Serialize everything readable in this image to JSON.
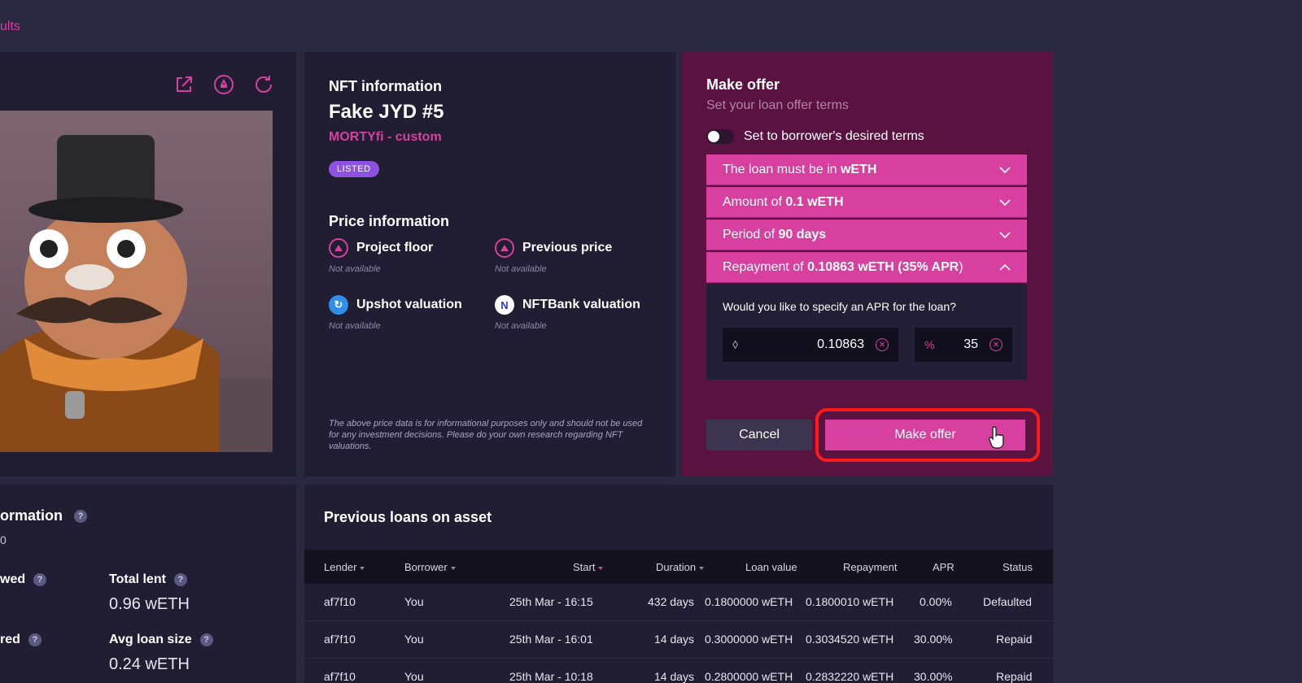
{
  "breadcrumb": {
    "text": "ults"
  },
  "info": {
    "heading": "NFT information",
    "nft_name": "Fake JYD #5",
    "collection": "MORTYfi - custom",
    "badge": "LISTED",
    "price_heading": "Price information",
    "items": [
      {
        "label": "Project floor",
        "value": "Not available",
        "icon": "floor-icon"
      },
      {
        "label": "Previous price",
        "value": "Not available",
        "icon": "price-icon"
      },
      {
        "label": "Upshot valuation",
        "value": "Not available",
        "icon": "upshot-icon"
      },
      {
        "label": "NFTBank valuation",
        "value": "Not available",
        "icon": "nftbank-icon"
      }
    ],
    "disclaimer": "The above price data is for informational purposes only and should not be used for any investment decisions. Please do your own research regarding NFT valuations."
  },
  "offer": {
    "title": "Make offer",
    "subtitle": "Set your loan offer terms",
    "toggle_label": "Set to borrower's desired terms",
    "rows": [
      {
        "prefix": "The loan must be in ",
        "bold": "wETH",
        "suffix": "",
        "expanded": false
      },
      {
        "prefix": "Amount of ",
        "bold": "0.1 wETH",
        "suffix": "",
        "expanded": false
      },
      {
        "prefix": "Period of ",
        "bold": "90 days",
        "suffix": "",
        "expanded": false
      },
      {
        "prefix": "Repayment of ",
        "bold": "0.10863 wETH (35% APR",
        "suffix": ")",
        "expanded": true
      }
    ],
    "apr_question": "Would you like to specify an APR for the loan?",
    "repayment_value": "0.10863",
    "apr_symbol": "%",
    "apr_value": "35",
    "cancel_label": "Cancel",
    "submit_label": "Make offer"
  },
  "stats": {
    "heading": "ormation",
    "sub": "0",
    "items": [
      {
        "label": "wed",
        "value": ""
      },
      {
        "label": "Total lent",
        "value": "0.96 wETH"
      },
      {
        "label": "red",
        "value": ""
      },
      {
        "label": "Avg loan size",
        "value": "0.24 wETH"
      }
    ]
  },
  "loans": {
    "heading": "Previous loans on asset",
    "columns": [
      "Lender",
      "Borrower",
      "Start",
      "Duration",
      "Loan value",
      "Repayment",
      "APR",
      "Status"
    ],
    "rows": [
      {
        "lender": "af7f10",
        "borrower": "You",
        "start": "25th Mar - 16:15",
        "duration": "432 days",
        "loan_value": "0.1800000 wETH",
        "repayment": "0.1800010 wETH",
        "apr": "0.00%",
        "status": "Defaulted"
      },
      {
        "lender": "af7f10",
        "borrower": "You",
        "start": "25th Mar - 16:01",
        "duration": "14 days",
        "loan_value": "0.3000000 wETH",
        "repayment": "0.3034520 wETH",
        "apr": "30.00%",
        "status": "Repaid"
      },
      {
        "lender": "af7f10",
        "borrower": "You",
        "start": "25th Mar - 10:18",
        "duration": "14 days",
        "loan_value": "0.2800000 wETH",
        "repayment": "0.2832220 wETH",
        "apr": "30.00%",
        "status": "Repaid"
      }
    ]
  },
  "colors": {
    "accent": "#d7409e",
    "panel": "#211e33",
    "offer_panel": "#5a1240",
    "background": "#2a2740"
  }
}
